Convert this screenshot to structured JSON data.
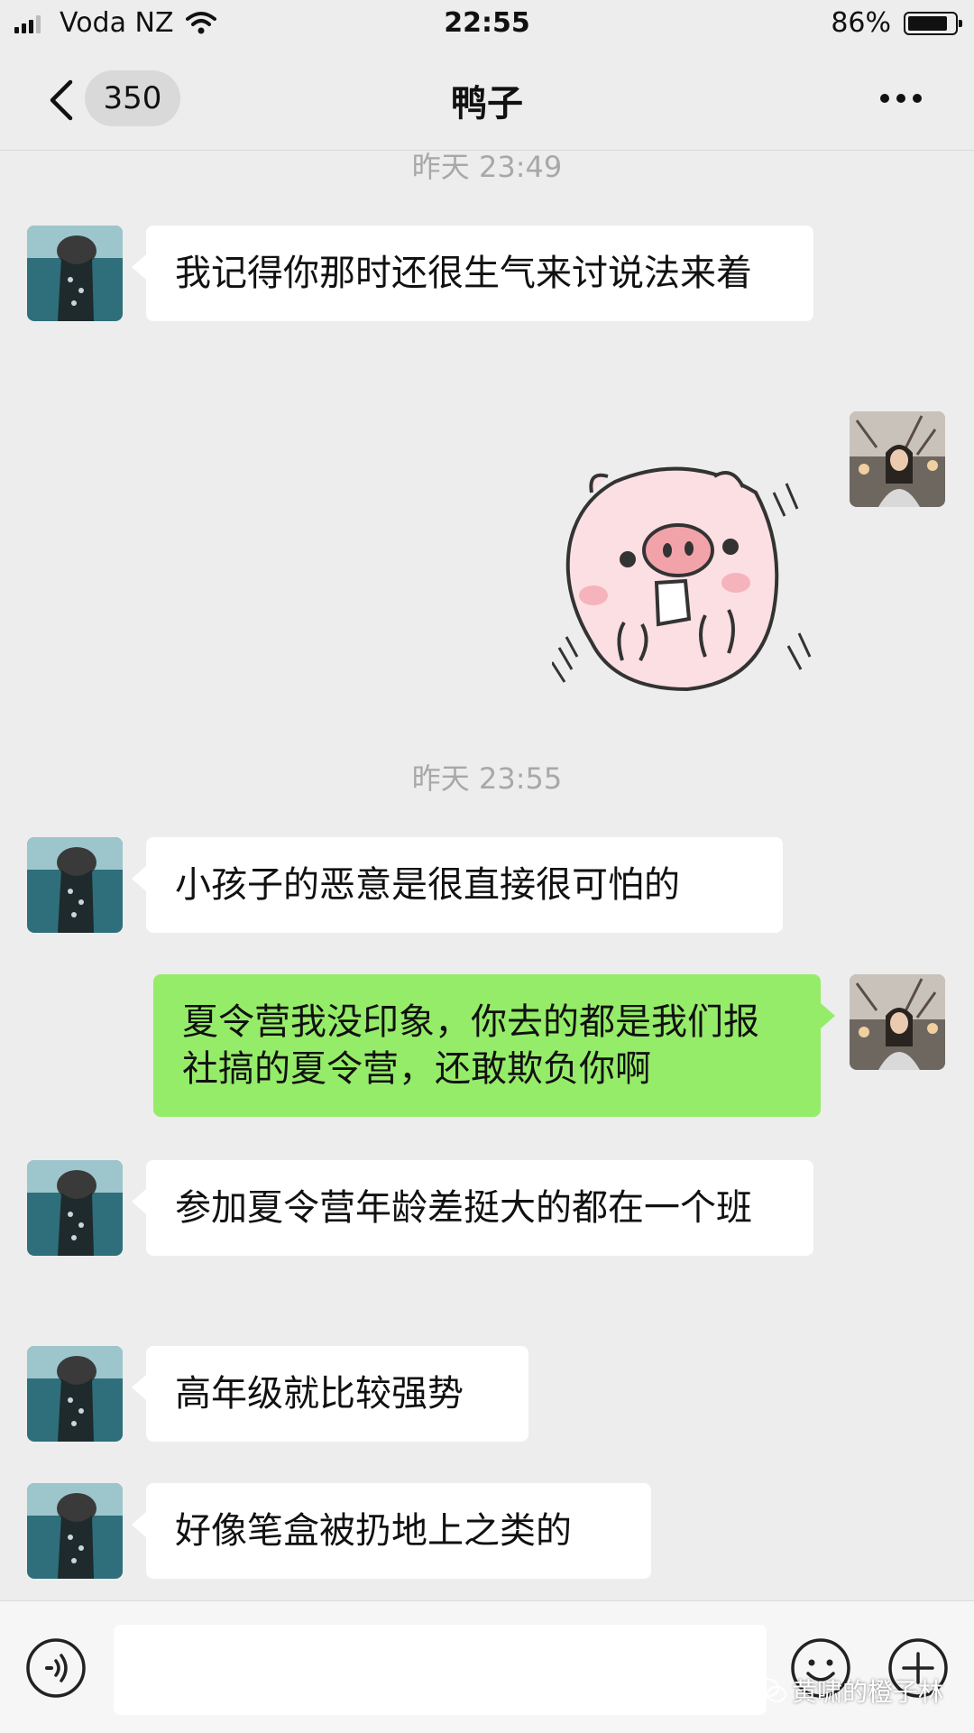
{
  "status_bar": {
    "carrier": "Voda NZ",
    "time": "22:55",
    "battery_percent": "86%",
    "battery_level": 0.86
  },
  "nav": {
    "unread_count": "350",
    "title": "鸭子"
  },
  "timestamps": [
    "昨天 23:49",
    "昨天 23:55"
  ],
  "messages": [
    {
      "side": "in",
      "text": "我记得你那时还很生气来讨说法来着"
    },
    {
      "side": "out",
      "type": "sticker",
      "icon": "pig-sticker"
    },
    {
      "side": "in",
      "text": "小孩子的恶意是很直接很可怕的"
    },
    {
      "side": "out",
      "text": "夏令营我没印象，你去的都是我们报社搞的夏令营，还敢欺负你啊"
    },
    {
      "side": "in",
      "text": "参加夏令营年龄差挺大的都在一个班"
    },
    {
      "side": "in",
      "text": "高年级就比较强势"
    },
    {
      "side": "in",
      "text": "好像笔盒被扔地上之类的"
    }
  ],
  "input": {
    "value": "",
    "icons": [
      "voice-icon",
      "emoji-icon",
      "plus-icon"
    ]
  },
  "watermark": "黄啸的橙子林",
  "colors": {
    "background": "#ededed",
    "outgoing_bubble": "#95ec69",
    "incoming_bubble": "#ffffff"
  }
}
